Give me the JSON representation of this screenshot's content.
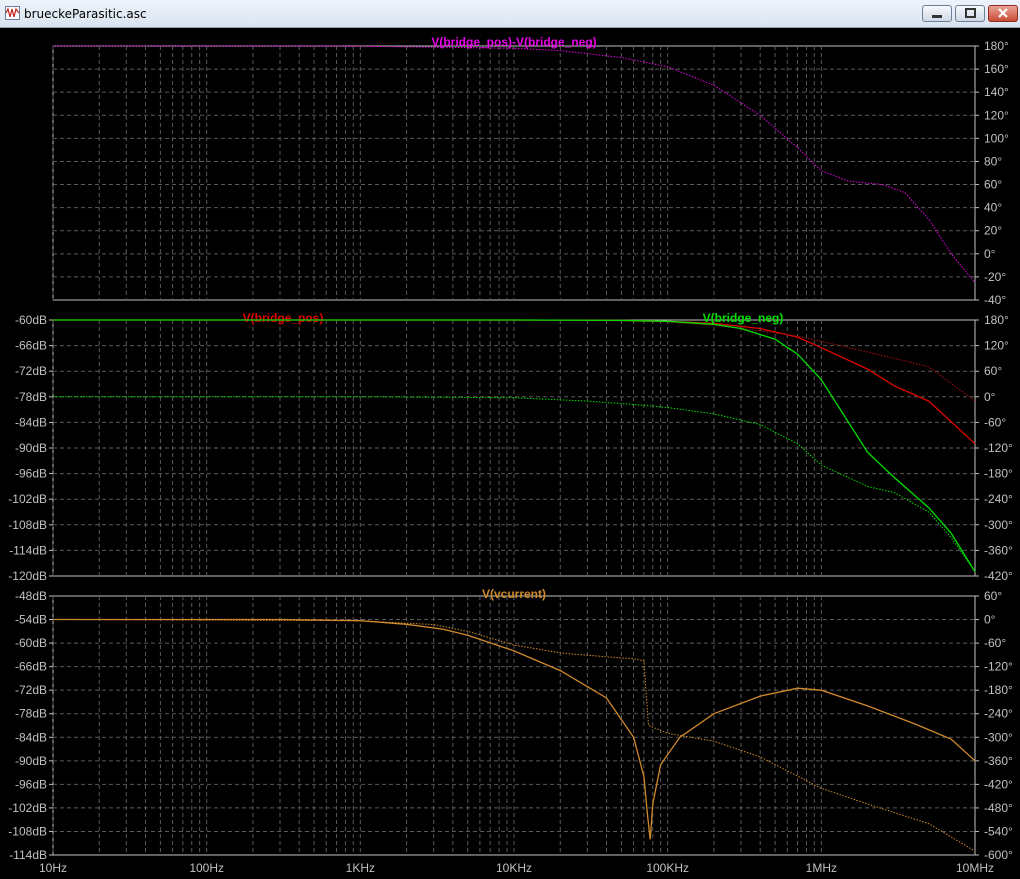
{
  "window": {
    "title": "brueckeParasitic.asc"
  },
  "colors": {
    "magenta": "#e800e8",
    "red": "#e00000",
    "darkred": "#b01010",
    "green": "#00e000",
    "orange": "#d08a2c",
    "axis": "#bfbfbf",
    "grid": "#5a5a5a",
    "label": "#c0c0c0"
  },
  "chart_data": [
    {
      "type": "line",
      "title": "",
      "xscale": "log",
      "xlim": [
        10,
        10000000
      ],
      "x_tick_labels": [
        "10Hz",
        "100Hz",
        "1KHz",
        "10KHz",
        "100KHz",
        "1MHz",
        "10MHz"
      ],
      "right_axis": {
        "lim": [
          -40,
          180
        ],
        "ticks": [
          180,
          160,
          140,
          120,
          100,
          80,
          60,
          40,
          20,
          0,
          -20,
          -40
        ],
        "tick_labels": [
          "180°",
          "160°",
          "140°",
          "120°",
          "100°",
          "80°",
          "60°",
          "40°",
          "20°",
          "0°",
          "-20°",
          "-40°"
        ]
      },
      "series": [
        {
          "name": "V(bridge_pos)-V(bridge_neg)",
          "color": "magenta",
          "axis": "right",
          "style": "dotted",
          "x": [
            10,
            1000,
            10000,
            20000,
            50000,
            100000,
            200000,
            400000,
            700000,
            1000000,
            1500000,
            2500000,
            3500000,
            5000000,
            7000000,
            10000000
          ],
          "y": [
            180,
            179.8,
            178,
            176,
            170,
            162,
            146,
            120,
            92,
            72,
            63,
            60,
            53,
            30,
            0,
            -25
          ]
        }
      ]
    },
    {
      "type": "line",
      "title": "",
      "xscale": "log",
      "xlim": [
        10,
        10000000
      ],
      "x_tick_labels": [
        "10Hz",
        "100Hz",
        "1KHz",
        "10KHz",
        "100KHz",
        "1MHz",
        "10MHz"
      ],
      "left_axis": {
        "lim": [
          -120,
          -60
        ],
        "ticks": [
          -60,
          -66,
          -72,
          -78,
          -84,
          -90,
          -96,
          -102,
          -108,
          -114,
          -120
        ],
        "tick_labels": [
          "-60dB",
          "-66dB",
          "-72dB",
          "-78dB",
          "-84dB",
          "-90dB",
          "-96dB",
          "-102dB",
          "-108dB",
          "-114dB",
          "-120dB"
        ]
      },
      "right_axis": {
        "lim": [
          -420,
          180
        ],
        "ticks": [
          180,
          120,
          60,
          0,
          -60,
          -120,
          -180,
          -240,
          -300,
          -360,
          -420
        ],
        "tick_labels": [
          "180°",
          "120°",
          "60°",
          "0°",
          "-60°",
          "-120°",
          "-180°",
          "-240°",
          "-300°",
          "-360°",
          "-420°"
        ]
      },
      "series": [
        {
          "name": "V(bridge_pos)",
          "color": "red",
          "axis": "left",
          "style": "solid",
          "x": [
            10,
            10000,
            50000,
            100000,
            200000,
            400000,
            700000,
            1000000,
            2000000,
            3000000,
            5000000,
            10000000
          ],
          "y": [
            -60,
            -60,
            -60.1,
            -60.3,
            -60.8,
            -62,
            -64,
            -66.5,
            -71.5,
            -75.5,
            -79,
            -89
          ]
        },
        {
          "name": "",
          "color": "darkred",
          "axis": "right",
          "style": "dotted",
          "x": [
            10,
            10000,
            50000,
            100000,
            200000,
            400000,
            700000,
            1000000,
            2000000,
            3000000,
            5000000,
            10000000
          ],
          "y": [
            180,
            179.5,
            178,
            175,
            168,
            155,
            142,
            130,
            105,
            90,
            70,
            -10
          ]
        },
        {
          "name": "V(bridge_neg)",
          "color": "green",
          "axis": "left",
          "style": "solid",
          "x": [
            10,
            10000,
            50000,
            100000,
            200000,
            300000,
            500000,
            700000,
            1000000,
            2000000,
            3000000,
            5000000,
            7000000,
            10000000
          ],
          "y": [
            -60,
            -60,
            -60.1,
            -60.3,
            -61,
            -62,
            -64.5,
            -68,
            -74,
            -91,
            -97,
            -104,
            -110,
            -119
          ]
        },
        {
          "name": "",
          "color": "green",
          "axis": "right",
          "style": "dotted",
          "x": [
            10,
            1000,
            10000,
            30000,
            60000,
            100000,
            200000,
            400000,
            700000,
            1000000,
            2000000,
            3000000,
            5000000,
            7000000,
            10000000
          ],
          "y": [
            0,
            0,
            -2,
            -10,
            -18,
            -25,
            -40,
            -65,
            -110,
            -160,
            -210,
            -225,
            -270,
            -330,
            -410
          ]
        }
      ]
    },
    {
      "type": "line",
      "title": "",
      "xscale": "log",
      "xlim": [
        10,
        10000000
      ],
      "x_tick_labels": [
        "10Hz",
        "100Hz",
        "1KHz",
        "10KHz",
        "100KHz",
        "1MHz",
        "10MHz"
      ],
      "left_axis": {
        "lim": [
          -114,
          -48
        ],
        "ticks": [
          -48,
          -54,
          -60,
          -66,
          -72,
          -78,
          -84,
          -90,
          -96,
          -102,
          -108,
          -114
        ],
        "tick_labels": [
          "-48dB",
          "-54dB",
          "-60dB",
          "-66dB",
          "-72dB",
          "-78dB",
          "-84dB",
          "-90dB",
          "-96dB",
          "-102dB",
          "-108dB",
          "-114dB"
        ]
      },
      "right_axis": {
        "lim": [
          -600,
          60
        ],
        "ticks": [
          60,
          0,
          -60,
          -120,
          -180,
          -240,
          -300,
          -360,
          -420,
          -480,
          -540,
          -600
        ],
        "tick_labels": [
          "60°",
          "0°",
          "-60°",
          "-120°",
          "-180°",
          "-240°",
          "-300°",
          "-360°",
          "-420°",
          "-480°",
          "-540°",
          "-600°"
        ]
      },
      "series": [
        {
          "name": "V(vcurrent)",
          "color": "orange",
          "axis": "left",
          "style": "solid",
          "x": [
            10,
            300,
            1000,
            2000,
            3500,
            5000,
            10000,
            20000,
            40000,
            60000,
            70000,
            74000,
            77000,
            80000,
            90000,
            120000,
            200000,
            400000,
            700000,
            1000000,
            2000000,
            4000000,
            7000000,
            10000000
          ],
          "y": [
            -54,
            -54,
            -54.3,
            -55.2,
            -56.5,
            -58,
            -62,
            -67,
            -74,
            -84,
            -94,
            -104,
            -110,
            -101,
            -91,
            -84,
            -78,
            -73.5,
            -71.5,
            -72,
            -76,
            -80.5,
            -84.5,
            -90
          ]
        },
        {
          "name": "",
          "color": "orange",
          "axis": "right",
          "style": "dotted",
          "x": [
            10,
            1000,
            3000,
            5000,
            10000,
            20000,
            40000,
            60000,
            70000,
            72000,
            75000,
            100000,
            200000,
            400000,
            1000000,
            2000000,
            5000000,
            10000000
          ],
          "y": [
            0,
            -3,
            -13,
            -30,
            -65,
            -85,
            -95,
            -100,
            -105,
            -170,
            -270,
            -290,
            -310,
            -350,
            -430,
            -470,
            -520,
            -590
          ]
        }
      ]
    }
  ]
}
